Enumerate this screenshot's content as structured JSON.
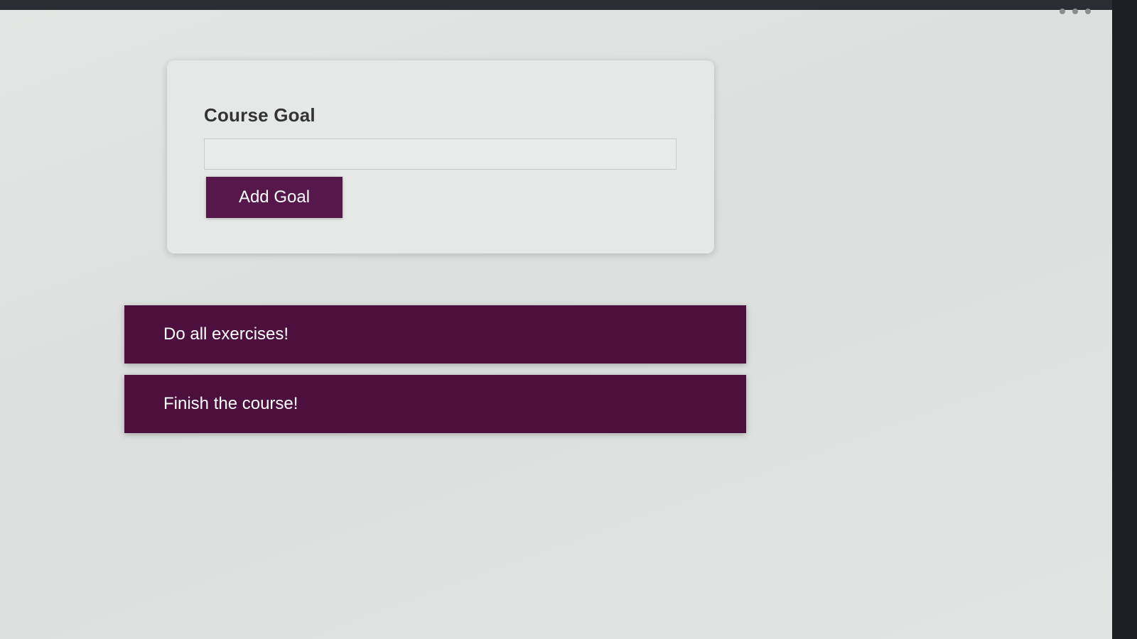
{
  "form": {
    "label": "Course Goal",
    "input_value": "",
    "input_placeholder": "",
    "button_label": "Add Goal"
  },
  "goals": [
    {
      "text": "Do all exercises!"
    },
    {
      "text": "Finish the course!"
    }
  ],
  "colors": {
    "accent": "#56184a",
    "goal_item": "#4d0f3d",
    "background": "#e2e4e3"
  }
}
